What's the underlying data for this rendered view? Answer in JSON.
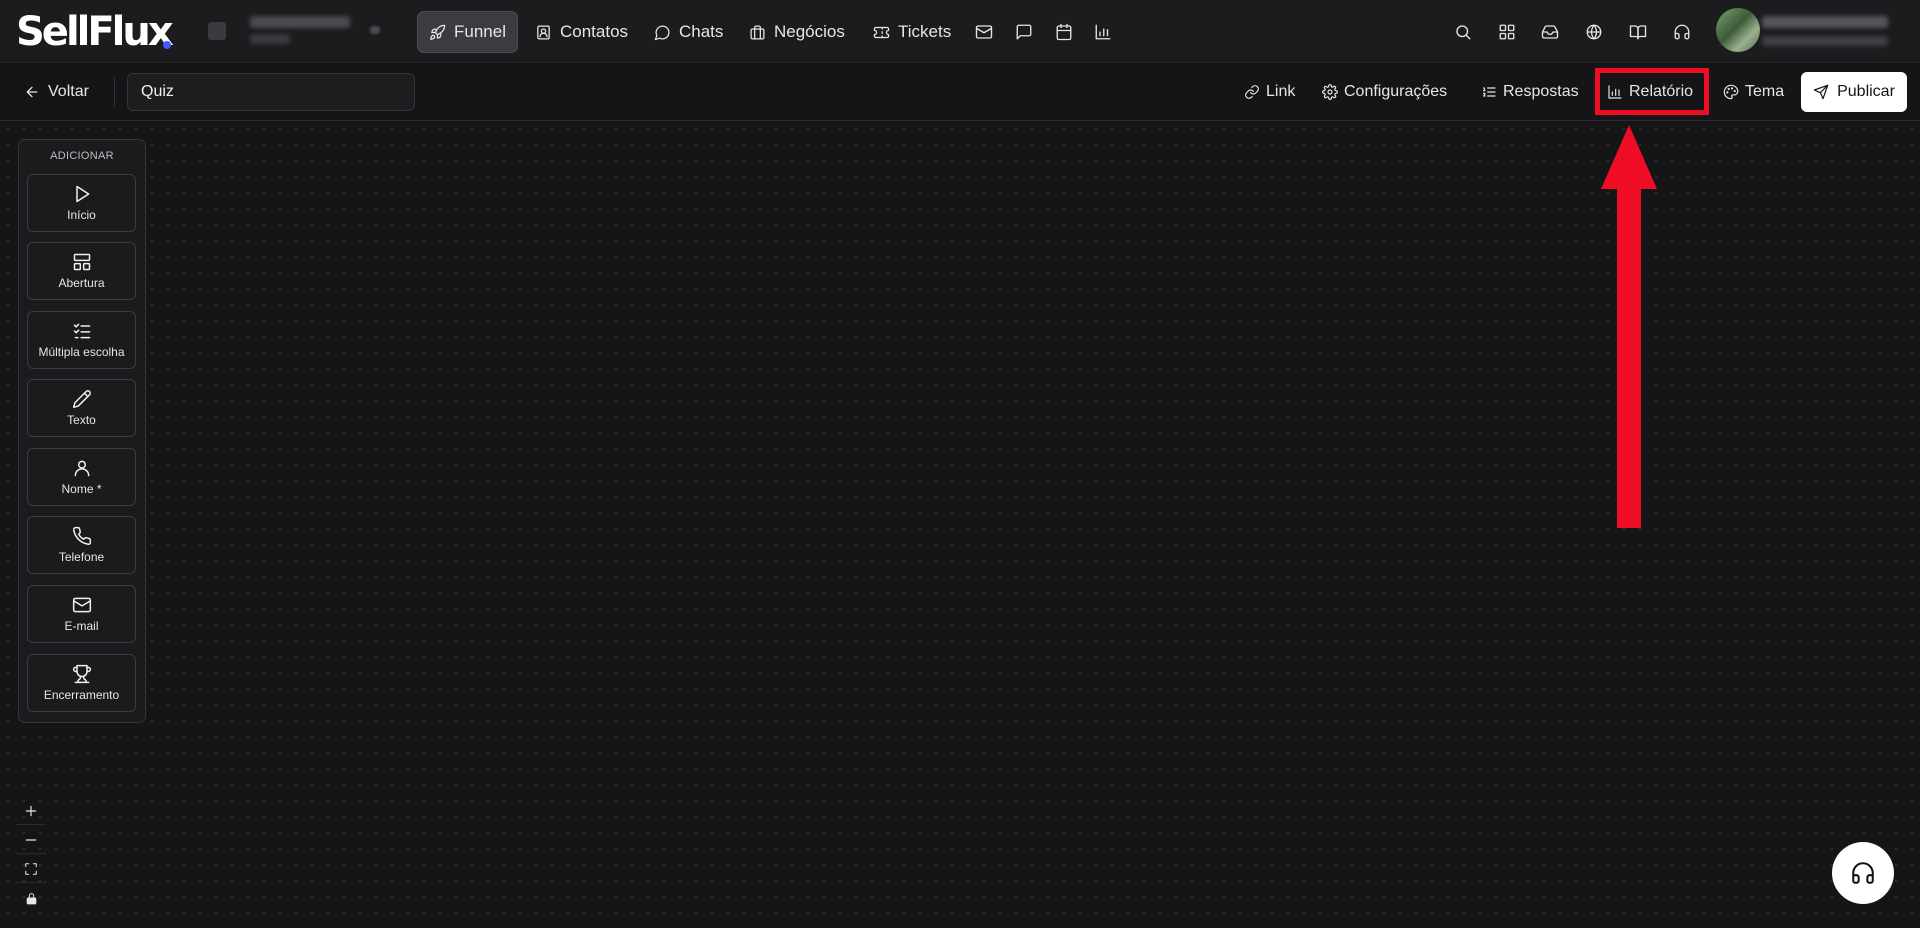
{
  "brand": {
    "logo_text": "SellFlux"
  },
  "nav": {
    "items": [
      {
        "label": "Funnel",
        "icon": "rocket-icon",
        "active": true
      },
      {
        "label": "Contatos",
        "icon": "contact-icon"
      },
      {
        "label": "Chats",
        "icon": "chat-icon"
      },
      {
        "label": "Negócios",
        "icon": "briefcase-icon"
      },
      {
        "label": "Tickets",
        "icon": "ticket-icon"
      }
    ],
    "extra_icons": [
      "mail-icon",
      "message-square-icon",
      "calendar-icon",
      "bar-chart-icon"
    ],
    "right_icons": [
      "search-icon",
      "grid-icon",
      "inbox-icon",
      "globe-icon",
      "book-icon",
      "headset-icon"
    ]
  },
  "toolbar": {
    "back_label": "Voltar",
    "title_value": "Quiz",
    "link_label": "Link",
    "config_label": "Configurações",
    "answers_label": "Respostas",
    "report_label": "Relatório",
    "theme_label": "Tema",
    "publish_label": "Publicar"
  },
  "panel": {
    "title": "ADICIONAR",
    "items": [
      {
        "label": "Início",
        "icon": "play-icon"
      },
      {
        "label": "Abertura",
        "icon": "layout-icon"
      },
      {
        "label": "Múltipla escolha",
        "icon": "checklist-icon"
      },
      {
        "label": "Texto",
        "icon": "pencil-icon"
      },
      {
        "label": "Nome *",
        "icon": "user-icon"
      },
      {
        "label": "Telefone",
        "icon": "phone-icon"
      },
      {
        "label": "E-mail",
        "icon": "mail-icon"
      },
      {
        "label": "Encerramento",
        "icon": "trophy-icon"
      }
    ]
  },
  "colors": {
    "highlight": "#ee0d24",
    "background": "#151517",
    "accent_dot": "#3b5bff"
  }
}
